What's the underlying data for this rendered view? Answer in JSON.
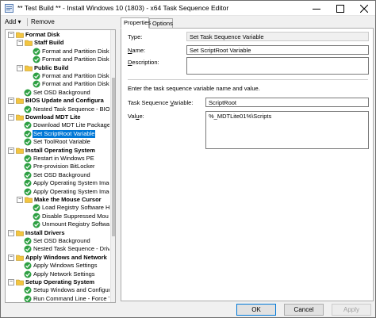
{
  "window": {
    "title": "** Test Build ** - Install Windows 10 (1803) - x64 Task Sequence Editor"
  },
  "toolbar": {
    "add_label": "Add",
    "add_arrow": "▾",
    "remove_label": "Remove"
  },
  "tree": {
    "items": [
      {
        "label": "Format Disk",
        "type": "group",
        "level": 1,
        "bold": true
      },
      {
        "label": "Staff Build",
        "type": "group",
        "level": 2,
        "bold": true
      },
      {
        "label": "Format and Partition Disk",
        "type": "step",
        "level": 3
      },
      {
        "label": "Format and Partition Disk",
        "type": "step",
        "level": 3
      },
      {
        "label": "Public Build",
        "type": "group",
        "level": 2,
        "bold": true
      },
      {
        "label": "Format and Partition Disk",
        "type": "step",
        "level": 3
      },
      {
        "label": "Format and Partition Disk",
        "type": "step",
        "level": 3
      },
      {
        "label": "Set OSD Background",
        "type": "step",
        "level": 2
      },
      {
        "label": "BIOS Update and Configura",
        "type": "group",
        "level": 1,
        "bold": true
      },
      {
        "label": "Nested Task Sequence - BIO",
        "type": "step",
        "level": 2
      },
      {
        "label": "Download MDT Lite",
        "type": "group",
        "level": 1,
        "bold": true
      },
      {
        "label": "Download MDT Lite Package",
        "type": "step",
        "level": 2
      },
      {
        "label": "Set ScriptRoot Variable",
        "type": "step",
        "level": 2,
        "selected": true
      },
      {
        "label": "Set ToolRoot Variable",
        "type": "step",
        "level": 2
      },
      {
        "label": "Install Operating System",
        "type": "group",
        "level": 1,
        "bold": true
      },
      {
        "label": "Restart in Windows PE",
        "type": "step",
        "level": 2
      },
      {
        "label": "Pre-provision BitLocker",
        "type": "step",
        "level": 2
      },
      {
        "label": "Set OSD Background",
        "type": "step",
        "level": 2
      },
      {
        "label": "Apply Operating System Imag",
        "type": "step",
        "level": 2
      },
      {
        "label": "Apply Operating System Imag",
        "type": "step",
        "level": 2
      },
      {
        "label": "Make the Mouse Cursor",
        "type": "group",
        "level": 2,
        "bold": true
      },
      {
        "label": "Load Registry Software H",
        "type": "step",
        "level": 3
      },
      {
        "label": "Disable Suppressed Mou",
        "type": "step",
        "level": 3
      },
      {
        "label": "Unmount Registry Softwa",
        "type": "step",
        "level": 3
      },
      {
        "label": "Install Drivers",
        "type": "group",
        "level": 1,
        "bold": true
      },
      {
        "label": "Set OSD Background",
        "type": "step",
        "level": 2
      },
      {
        "label": "Nested Task Sequence - Driv",
        "type": "step",
        "level": 2
      },
      {
        "label": "Apply Windows and Network",
        "type": "group",
        "level": 1,
        "bold": true
      },
      {
        "label": "Apply Windows Settings",
        "type": "step",
        "level": 2
      },
      {
        "label": "Apply Network Settings",
        "type": "step",
        "level": 2
      },
      {
        "label": "Setup Operating System",
        "type": "group",
        "level": 1,
        "bold": true
      },
      {
        "label": "Setup Windows and Configur",
        "type": "step",
        "level": 2
      },
      {
        "label": "Run Command Line - Force T",
        "type": "step",
        "level": 2
      }
    ]
  },
  "tabs": [
    {
      "label": "Properties",
      "active": true
    },
    {
      "label": "Options",
      "active": false
    }
  ],
  "properties": {
    "type_label": "Type:",
    "type_value": "Set Task Sequence Variable",
    "name_label": "Name:",
    "name_value": "Set ScriptRoot Variable",
    "description_label": "Description:",
    "description_value": "",
    "instruction": "Enter the task sequence variable name and value.",
    "variable_label": "Task Sequence Variable:",
    "variable_value": "ScriptRoot",
    "value_label": "Value:",
    "value_value": "%_MDTLite01%\\Scripts"
  },
  "buttons": {
    "ok": "OK",
    "cancel": "Cancel",
    "apply": "Apply"
  },
  "colors": {
    "selection": "#0078d7",
    "check_green": "#2ea043",
    "folder_yellow": "#f3c540"
  }
}
